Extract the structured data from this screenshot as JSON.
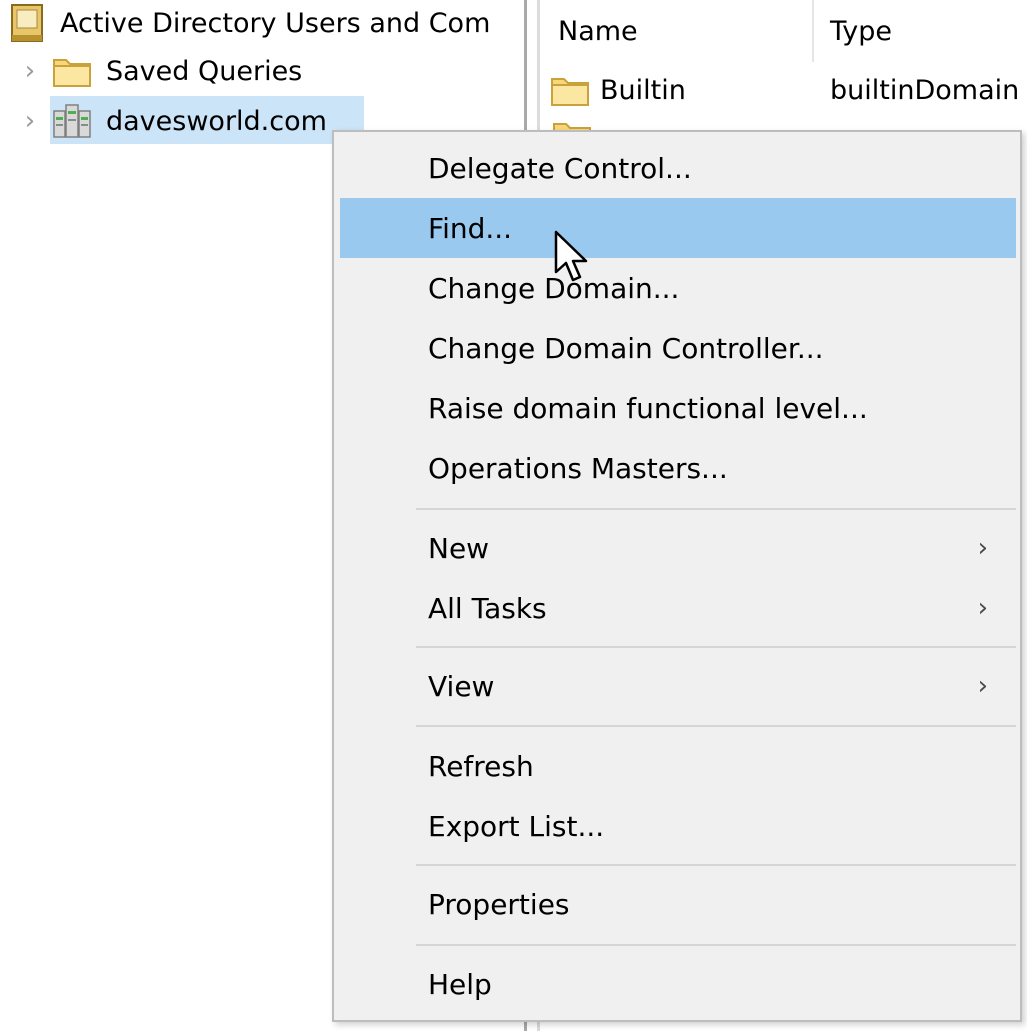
{
  "tree": {
    "root_label": "Active Directory Users and Com",
    "saved_queries_label": "Saved Queries",
    "domain_label": "davesworld.com",
    "expander_glyph": "›"
  },
  "list": {
    "columns": [
      "Name",
      "Type"
    ],
    "rows": [
      {
        "name": "Builtin",
        "type": "builtinDomain"
      }
    ]
  },
  "context_menu": {
    "items": [
      {
        "label": "Delegate Control..."
      },
      {
        "label": "Find..."
      },
      {
        "label": "Change Domain..."
      },
      {
        "label": "Change Domain Controller..."
      },
      {
        "label": "Raise domain functional level..."
      },
      {
        "label": "Operations Masters..."
      },
      {
        "label": "New"
      },
      {
        "label": "All Tasks"
      },
      {
        "label": "View"
      },
      {
        "label": "Refresh"
      },
      {
        "label": "Export List..."
      },
      {
        "label": "Properties"
      },
      {
        "label": "Help"
      }
    ],
    "submenu_glyph": "›",
    "highlighted_item": "Find..."
  },
  "colors": {
    "highlight": "#99c9ef",
    "selection": "#cce4f7",
    "menu_background": "#f0f0f0"
  }
}
